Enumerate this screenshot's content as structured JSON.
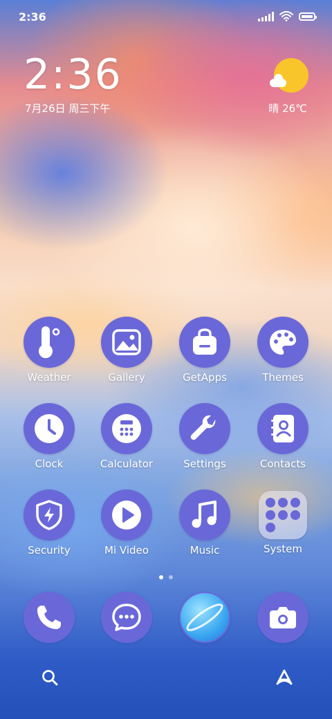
{
  "status_bar": {
    "time": "2:36"
  },
  "lockclock": {
    "time": "2:36",
    "date": "7月26日 周三下午"
  },
  "weather": {
    "summary": "晴 26℃"
  },
  "apps": [
    {
      "label": "Weather",
      "icon": "thermometer-icon"
    },
    {
      "label": "Gallery",
      "icon": "image-icon"
    },
    {
      "label": "GetApps",
      "icon": "bag-icon"
    },
    {
      "label": "Themes",
      "icon": "palette-icon"
    },
    {
      "label": "Clock",
      "icon": "clock-icon"
    },
    {
      "label": "Calculator",
      "icon": "calculator-icon"
    },
    {
      "label": "Settings",
      "icon": "wrench-icon"
    },
    {
      "label": "Contacts",
      "icon": "contacts-book-icon"
    },
    {
      "label": "Security",
      "icon": "shield-bolt-icon"
    },
    {
      "label": "Mi Video",
      "icon": "play-icon"
    },
    {
      "label": "Music",
      "icon": "music-note-icon"
    },
    {
      "label": "System",
      "icon": "folder-icon"
    }
  ],
  "dock": [
    {
      "name": "Phone",
      "icon": "phone-icon"
    },
    {
      "name": "Messages",
      "icon": "chat-bubble-icon"
    },
    {
      "name": "Browser",
      "icon": "planet-icon"
    },
    {
      "name": "Camera",
      "icon": "camera-icon"
    }
  ],
  "colors": {
    "icon_bg": "#6a68d8",
    "sun": "#f8c52b"
  },
  "page_indicator": {
    "pages": 2,
    "current": 1
  }
}
